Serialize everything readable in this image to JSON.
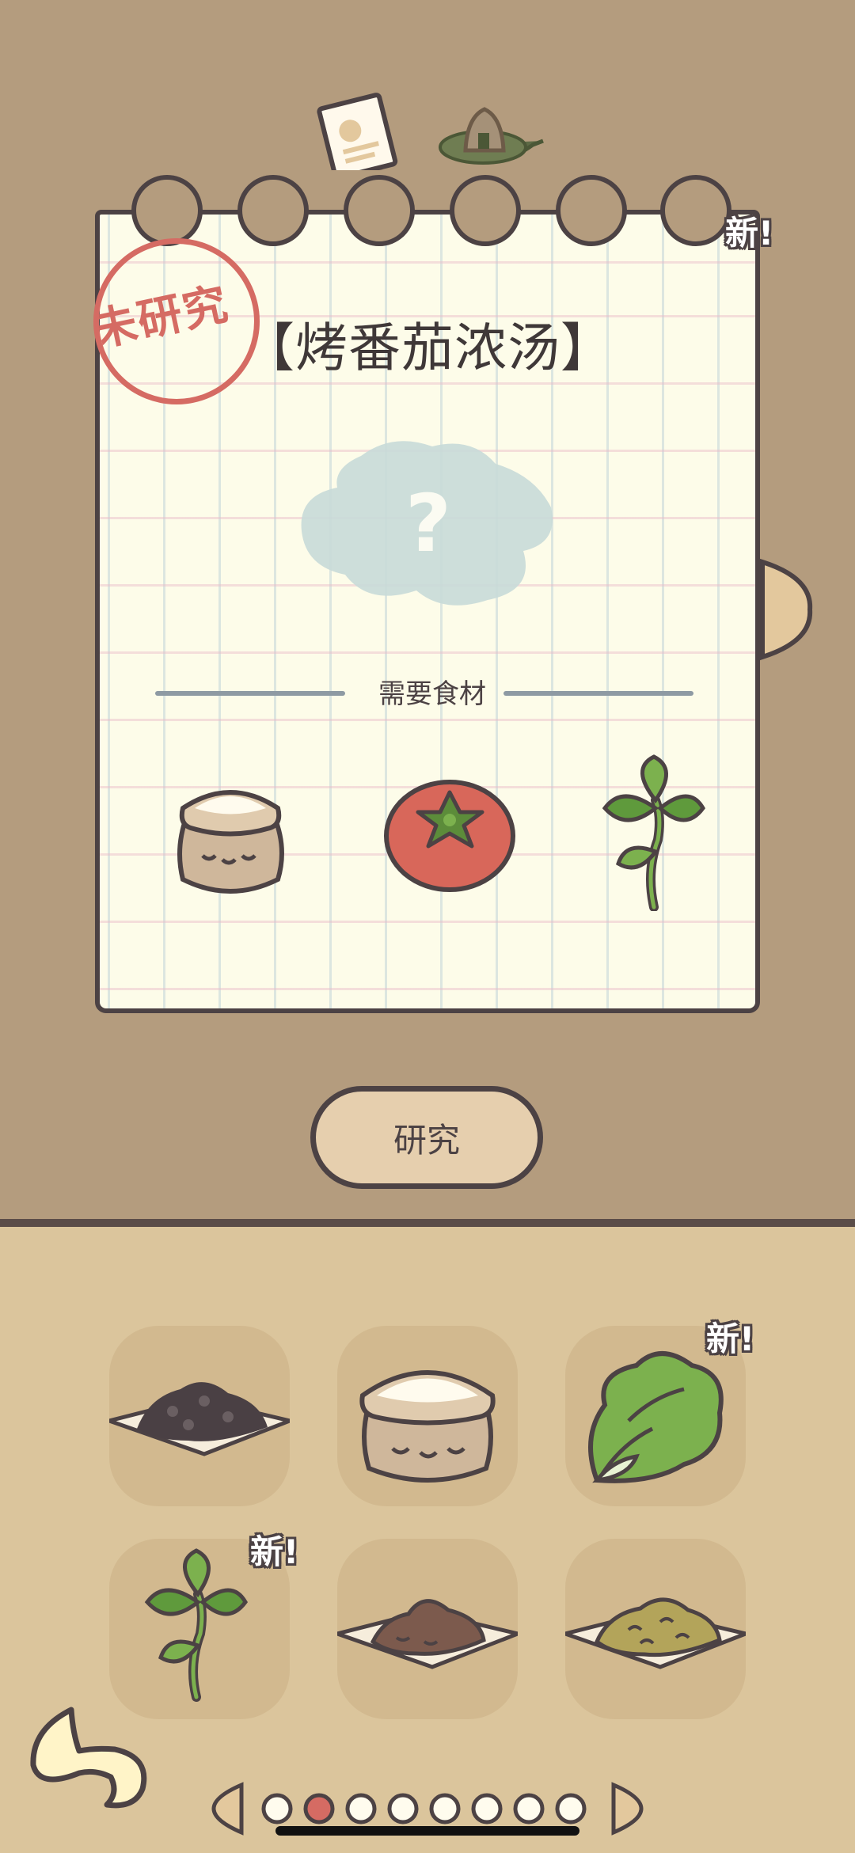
{
  "notebook": {
    "status_stamp": "未研究",
    "dish_name": "【烤番茄浓汤】",
    "new_badge": "新!",
    "unknown_mark": "?",
    "ingredients_header": "需要食材",
    "required_ingredients": [
      {
        "icon": "flour-sack-icon"
      },
      {
        "icon": "tomato-icon"
      },
      {
        "icon": "basil-icon"
      }
    ]
  },
  "actions": {
    "research_label": "研究"
  },
  "inventory": {
    "items": [
      {
        "icon": "black-bean-pile-icon",
        "new": ""
      },
      {
        "icon": "flour-sack-icon",
        "new": ""
      },
      {
        "icon": "lettuce-icon",
        "new": "新!"
      },
      {
        "icon": "basil-icon",
        "new": "新!"
      },
      {
        "icon": "brown-paste-pile-icon",
        "new": ""
      },
      {
        "icon": "yellow-grain-pile-icon",
        "new": ""
      }
    ]
  },
  "pager": {
    "total_pages": 8,
    "current_page": 2
  },
  "colors": {
    "background_top": "#b49c7e",
    "background_bottom": "#dbc59c",
    "outline": "#4c4244",
    "stamp": "#d56b63",
    "active_dot": "#d56b63"
  }
}
